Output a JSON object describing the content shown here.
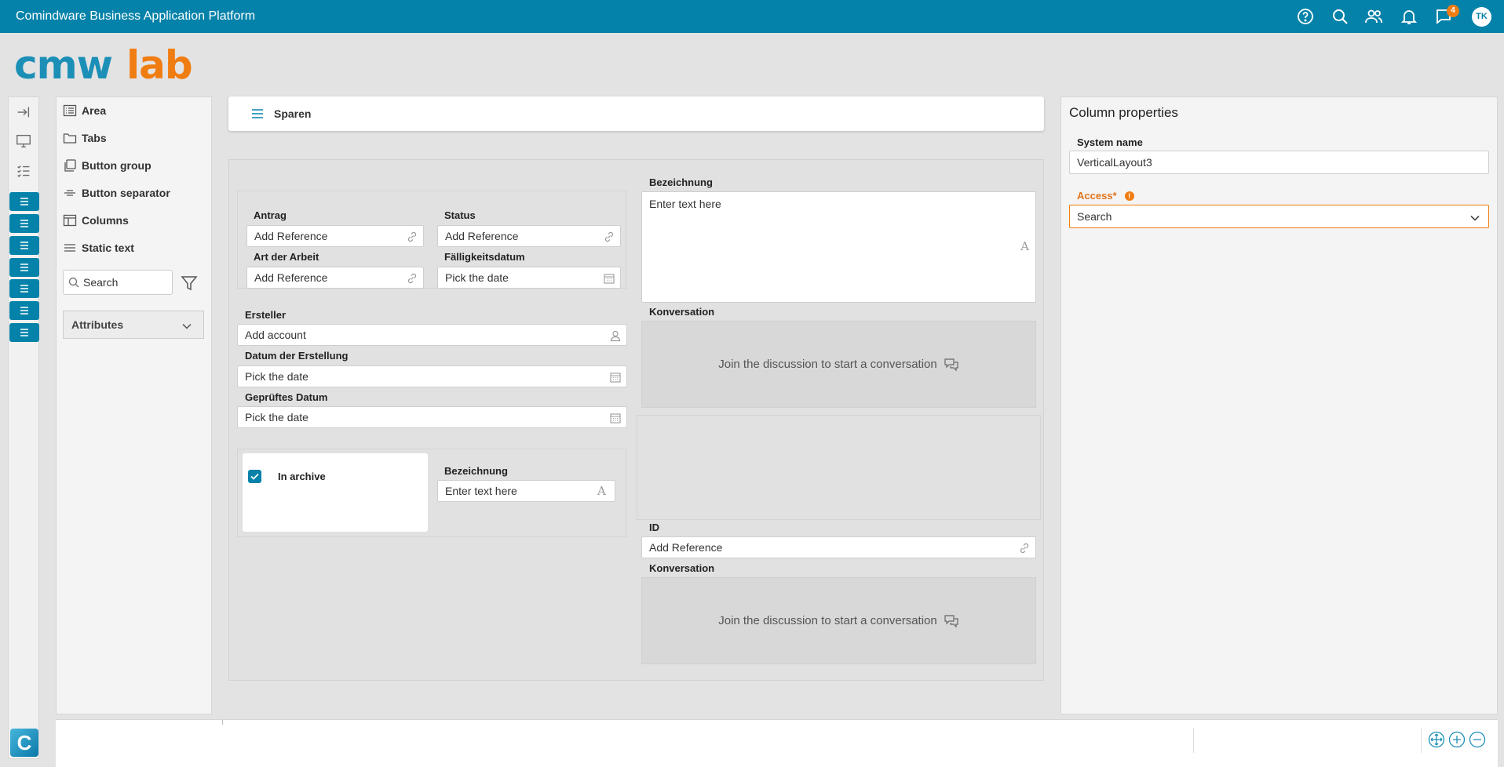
{
  "app": {
    "title": "Comindware Business Application Platform",
    "notification_count": "4",
    "user_initials": "TK"
  },
  "logo": {
    "part1": "cmw",
    "part2": "lab"
  },
  "palette": {
    "items": [
      {
        "label": "Area",
        "icon": "list-icon"
      },
      {
        "label": "Tabs",
        "icon": "folder-icon"
      },
      {
        "label": "Button group",
        "icon": "copy-icon"
      },
      {
        "label": "Button separator",
        "icon": "separator-icon"
      },
      {
        "label": "Columns",
        "icon": "columns-icon"
      },
      {
        "label": "Static text",
        "icon": "lines-icon"
      }
    ],
    "search_placeholder": "Search",
    "attributes_label": "Attributes"
  },
  "toolbar": {
    "save_label": "Sparen"
  },
  "form": {
    "antrag": {
      "label": "Antrag",
      "value": "Add Reference"
    },
    "status": {
      "label": "Status",
      "value": "Add Reference"
    },
    "art": {
      "label": "Art der Arbeit",
      "value": "Add Reference"
    },
    "faellig": {
      "label": "Fälligkeitsdatum",
      "value": "Pick the date"
    },
    "ersteller": {
      "label": "Ersteller",
      "value": "Add account"
    },
    "datum_erstellung": {
      "label": "Datum der Erstellung",
      "value": "Pick the date"
    },
    "geprueft": {
      "label": "Geprüftes Datum",
      "value": "Pick the date"
    },
    "in_archive": {
      "label": "In archive",
      "checked": true
    },
    "bezeichnung_small": {
      "label": "Bezeichnung",
      "value": "Enter text here"
    },
    "bezeichnung_large": {
      "label": "Bezeichnung",
      "value": "Enter text here"
    },
    "konversation1": {
      "label": "Konversation",
      "text": "Join the discussion to start a conversation"
    },
    "id": {
      "label": "ID",
      "value": "Add Reference"
    },
    "konversation2": {
      "label": "Konversation",
      "text": "Join the discussion to start a conversation"
    }
  },
  "properties": {
    "title": "Column properties",
    "system_name_label": "System name",
    "system_name_value": "VerticalLayout3",
    "access_label": "Access*",
    "access_value": "Search"
  },
  "colors": {
    "primary": "#0582a9",
    "accent": "#f07d12"
  }
}
